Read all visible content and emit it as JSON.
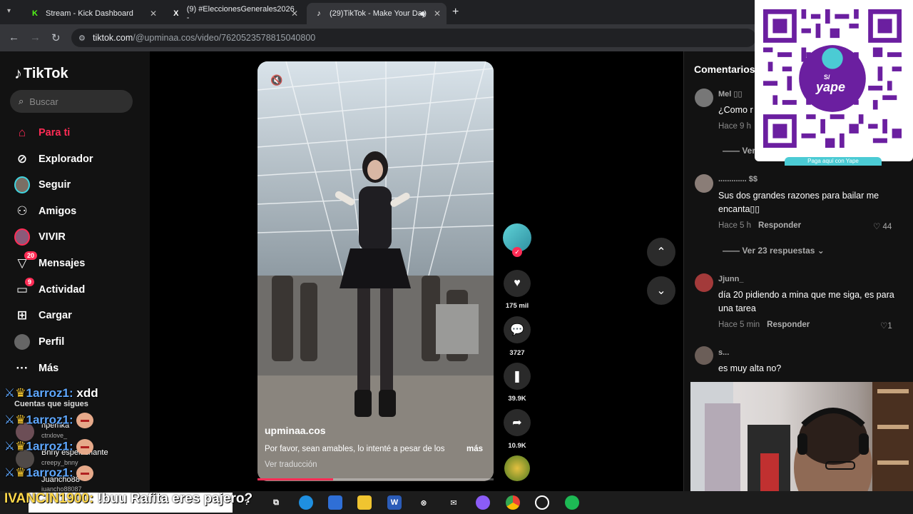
{
  "browser": {
    "tabs": [
      {
        "title": "Stream - Kick Dashboard",
        "favicon": "K",
        "active": false
      },
      {
        "title": "(9) #EleccionesGenerales2026 -",
        "favicon": "X",
        "active": false
      },
      {
        "title": "(29)TikTok - Make Your Day",
        "favicon": "♪",
        "active": true
      }
    ],
    "url_host": "tiktok.com",
    "url_path": "/@upminaa.cos/video/7620523578815040800"
  },
  "sidebar": {
    "logo": "TikTok",
    "search_placeholder": "Buscar",
    "items": [
      {
        "label": "Para ti",
        "icon": "home-icon",
        "active": true
      },
      {
        "label": "Explorador",
        "icon": "compass-icon"
      },
      {
        "label": "Seguir",
        "icon": "following-avatar-icon"
      },
      {
        "label": "Amigos",
        "icon": "friends-icon"
      },
      {
        "label": "VIVIR",
        "icon": "live-icon"
      },
      {
        "label": "Mensajes",
        "icon": "messages-icon",
        "badge": "20"
      },
      {
        "label": "Actividad",
        "icon": "activity-icon",
        "badge": "9"
      },
      {
        "label": "Cargar",
        "icon": "upload-icon"
      },
      {
        "label": "Perfil",
        "icon": "profile-icon"
      },
      {
        "label": "Más",
        "icon": "more-icon"
      }
    ],
    "following_title": "Cuentas que sigues",
    "following": [
      {
        "name": "hpemka",
        "handle": "ctrxlove_"
      },
      {
        "name": "Bnny espeluznante",
        "handle": "creepy_bnny"
      },
      {
        "name": "Juancho88",
        "handle": "juancho88087"
      }
    ]
  },
  "chat_overlay": {
    "messages": [
      {
        "user": "1arroz1:",
        "text": "xdd"
      },
      {
        "user": "1arroz1:",
        "text": ""
      },
      {
        "user": "1arroz1:",
        "text": ""
      },
      {
        "user": "1arroz1:",
        "text": ""
      }
    ],
    "big_message": {
      "user": "IVANCIN1900:",
      "text": "!buu Rafita eres pajero?"
    }
  },
  "video": {
    "username": "upminaa.cos",
    "description": "Por favor, sean amables, lo intenté a pesar de los",
    "more": "más",
    "translate": "Ver traducción",
    "progress": 0.32,
    "sound_icon": "muted-speaker-icon"
  },
  "actions": {
    "likes": "175 mil",
    "comments": "3727",
    "saves": "39.9K",
    "shares": "10.9K"
  },
  "comments_panel": {
    "title": "Comentarios",
    "items": [
      {
        "name": "Mel ▯▯",
        "text": "¿Como r",
        "time": "Hace 9 h",
        "reply": "",
        "likes": "",
        "more": "Ver"
      },
      {
        "name": "............. $$",
        "text": "Sus dos grandes razones para bailar me encanta▯▯",
        "time": "Hace 5 h",
        "reply": "Responder",
        "likes": "44",
        "more": "Ver 23 respuestas"
      },
      {
        "name": "Jjunn_",
        "text": "día 20 pidiendo a mina que me siga, es para una tarea",
        "time": "Hace 5 min",
        "reply": "Responder",
        "likes": "1",
        "more": ""
      },
      {
        "name": "s...",
        "text": "es muy alta no?",
        "time": "",
        "reply": "",
        "likes": "",
        "more": ""
      }
    ]
  },
  "qr_overlay": {
    "brand": "yape",
    "currency": "S/",
    "label": "Paga aquí con Yape"
  },
  "colors": {
    "accent": "#fe2c55",
    "chat_user": "#5fa8ff",
    "qr_purple": "#6b1fa0"
  }
}
